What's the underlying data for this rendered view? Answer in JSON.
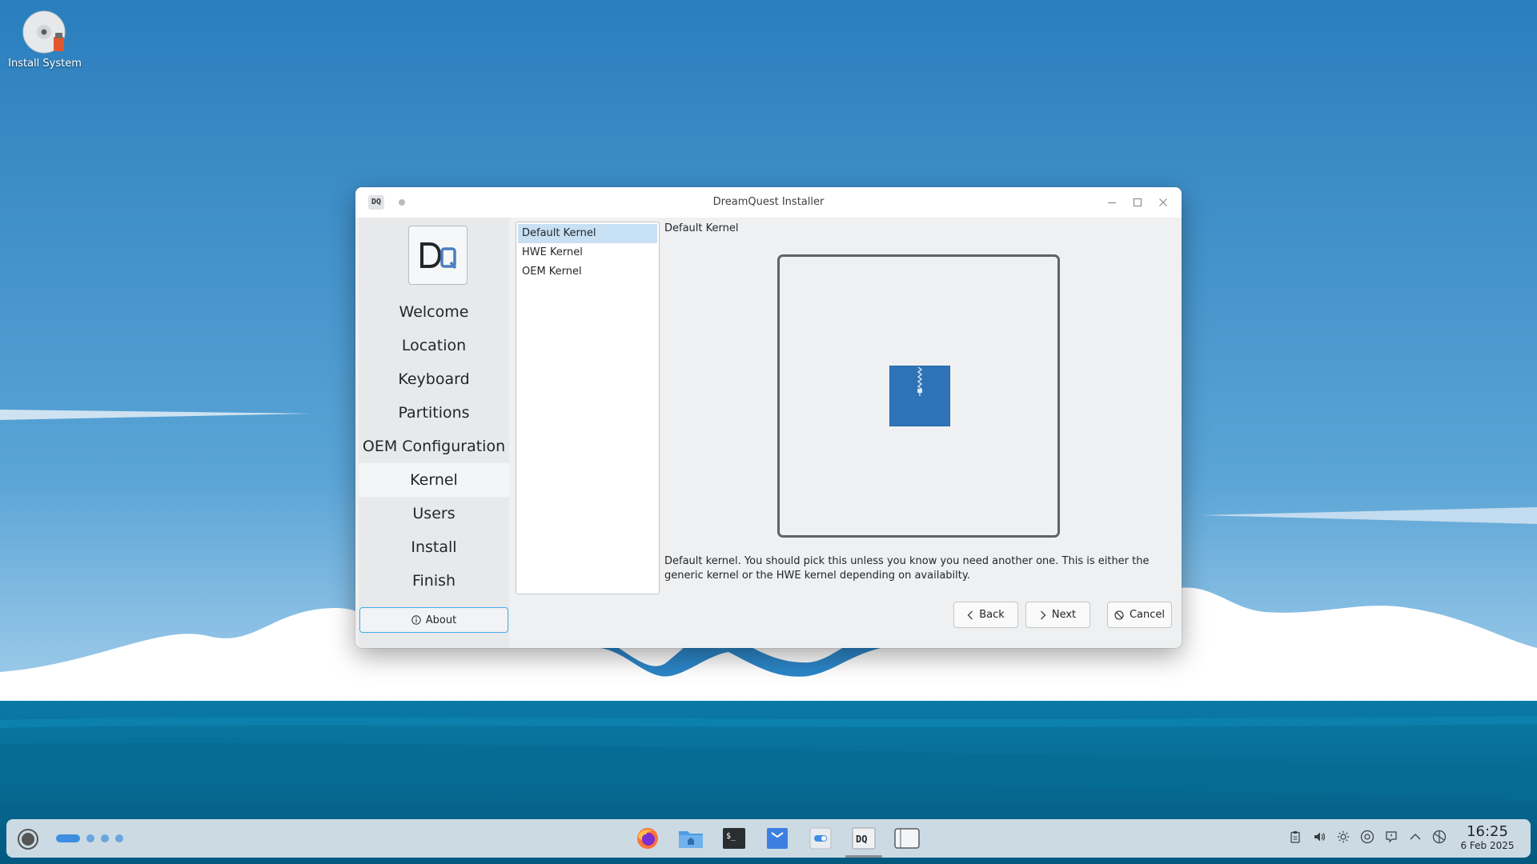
{
  "desktop": {
    "icon_label": "Install System"
  },
  "window": {
    "title": "DreamQuest Installer",
    "logo_text": "DQ"
  },
  "sidebar": {
    "items": [
      {
        "label": "Welcome",
        "active": false
      },
      {
        "label": "Location",
        "active": false
      },
      {
        "label": "Keyboard",
        "active": false
      },
      {
        "label": "Partitions",
        "active": false
      },
      {
        "label": "OEM Configuration",
        "active": false
      },
      {
        "label": "Kernel",
        "active": true
      },
      {
        "label": "Users",
        "active": false
      },
      {
        "label": "Install",
        "active": false
      },
      {
        "label": "Finish",
        "active": false
      }
    ],
    "about_label": "About"
  },
  "kernels": {
    "items": [
      "Default Kernel",
      "HWE Kernel",
      "OEM Kernel"
    ],
    "selected": "Default Kernel"
  },
  "detail": {
    "title": "Default Kernel",
    "description": "Default kernel. You should pick this unless you know you need another one. This is either the generic kernel or the HWE kernel depending on availabilty."
  },
  "buttons": {
    "back": "Back",
    "next": "Next",
    "cancel": "Cancel"
  },
  "taskbar": {
    "tasks": [
      "firefox-icon",
      "file-manager-icon",
      "terminal-icon",
      "discover-icon",
      "settings-icon",
      "installer-icon",
      "blank-window-icon"
    ],
    "time": "16:25",
    "date": "6 Feb 2025"
  },
  "colors": {
    "accent": "#3daee9",
    "selection": "#c8e0f4"
  }
}
